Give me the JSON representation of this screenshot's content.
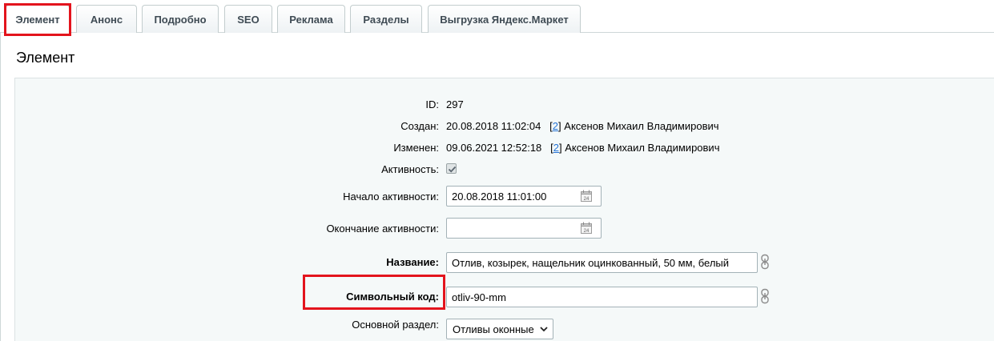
{
  "tabs": [
    {
      "label": "Элемент",
      "active": true
    },
    {
      "label": "Анонс"
    },
    {
      "label": "Подробно"
    },
    {
      "label": "SEO"
    },
    {
      "label": "Реклама"
    },
    {
      "label": "Разделы"
    },
    {
      "label": "Выгрузка Яндекс.Маркет"
    }
  ],
  "panel": {
    "title": "Элемент"
  },
  "form": {
    "id": {
      "label": "ID:",
      "value": "297"
    },
    "created": {
      "label": "Создан:",
      "date": "20.08.2018 11:02:04",
      "user_open": "[",
      "user_id": "2",
      "user_close": "]",
      "user_name": "Аксенов Михаил Владимирович"
    },
    "modified": {
      "label": "Изменен:",
      "date": "09.06.2021 12:52:18",
      "user_open": "[",
      "user_id": "2",
      "user_close": "]",
      "user_name": "Аксенов Михаил Владимирович"
    },
    "active": {
      "label": "Активность:",
      "checked": true
    },
    "active_from": {
      "label": "Начало активности:",
      "value": "20.08.2018 11:01:00"
    },
    "active_to": {
      "label": "Окончание активности:",
      "value": ""
    },
    "name": {
      "label": "Название:",
      "value": "Отлив, козырек, нащельник оцинкованный, 50 мм, белый"
    },
    "code": {
      "label": "Символьный код:",
      "value": "otliv-90-mm"
    },
    "section": {
      "label": "Основной раздел:",
      "value": "Отливы оконные"
    }
  },
  "calendar_day": "24",
  "icons": {
    "calendar": "calendar-icon",
    "chain": "link-chain-icon",
    "check": "checkmark-icon",
    "dropdown": "chevron-down-icon"
  },
  "colors": {
    "highlight": "#e3141d",
    "link": "#2675d7",
    "form_bg": "#f5f9f9"
  }
}
